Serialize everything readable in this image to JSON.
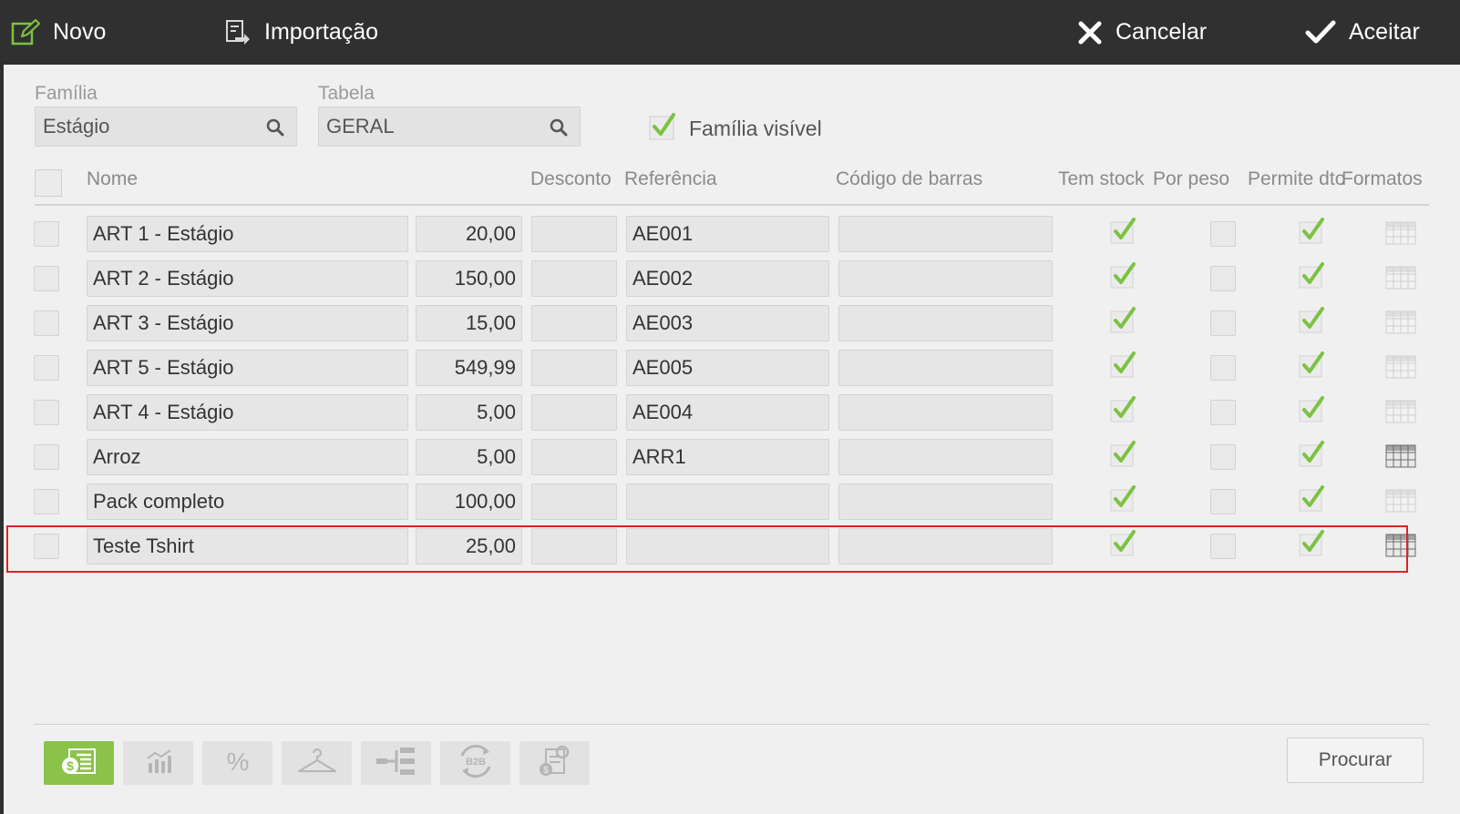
{
  "toolbar": {
    "novo": "Novo",
    "importacao": "Importação",
    "cancelar": "Cancelar",
    "aceitar": "Aceitar"
  },
  "filters": {
    "familia_label": "Família",
    "familia_value": "Estágio",
    "tabela_label": "Tabela",
    "tabela_value": "GERAL",
    "familia_visivel_label": "Família visível",
    "familia_visivel_checked": true
  },
  "grid": {
    "headers": {
      "nome": "Nome",
      "desconto": "Desconto",
      "referencia": "Referência",
      "codigo_barras": "Código de barras",
      "tem_stock": "Tem stock",
      "por_peso": "Por peso",
      "permite_dto": "Permite dto",
      "formatos": "Formatos"
    },
    "rows": [
      {
        "nome": "ART 1 - Estágio",
        "preco": "20,00",
        "desconto": "",
        "referencia": "AE001",
        "codigo_barras": "",
        "tem_stock": true,
        "por_peso": false,
        "permite_dto": true,
        "formatos_active": false
      },
      {
        "nome": "ART 2 - Estágio",
        "preco": "150,00",
        "desconto": "",
        "referencia": "AE002",
        "codigo_barras": "",
        "tem_stock": true,
        "por_peso": false,
        "permite_dto": true,
        "formatos_active": false
      },
      {
        "nome": "ART 3 - Estágio",
        "preco": "15,00",
        "desconto": "",
        "referencia": "AE003",
        "codigo_barras": "",
        "tem_stock": true,
        "por_peso": false,
        "permite_dto": true,
        "formatos_active": false
      },
      {
        "nome": "ART 5 -  Estágio",
        "preco": "549,99",
        "desconto": "",
        "referencia": "AE005",
        "codigo_barras": "",
        "tem_stock": true,
        "por_peso": false,
        "permite_dto": true,
        "formatos_active": false
      },
      {
        "nome": "ART 4 - Estágio",
        "preco": "5,00",
        "desconto": "",
        "referencia": "AE004",
        "codigo_barras": "",
        "tem_stock": true,
        "por_peso": false,
        "permite_dto": true,
        "formatos_active": false
      },
      {
        "nome": "Arroz",
        "preco": "5,00",
        "desconto": "",
        "referencia": "ARR1",
        "codigo_barras": "",
        "tem_stock": true,
        "por_peso": false,
        "permite_dto": true,
        "formatos_active": true
      },
      {
        "nome": "Pack completo",
        "preco": "100,00",
        "desconto": "",
        "referencia": "",
        "codigo_barras": "",
        "tem_stock": true,
        "por_peso": false,
        "permite_dto": true,
        "formatos_active": false
      },
      {
        "nome": "Teste Tshirt",
        "preco": "25,00",
        "desconto": "",
        "referencia": "",
        "codigo_barras": "",
        "tem_stock": true,
        "por_peso": false,
        "permite_dto": true,
        "formatos_active": true
      }
    ]
  },
  "bottom": {
    "tools": [
      "price-list-icon",
      "chart-icon",
      "percent-icon",
      "hanger-icon",
      "hierarchy-icon",
      "b2b-icon",
      "price-settings-icon"
    ],
    "procurar": "Procurar"
  },
  "colors": {
    "toolbar_bg": "#303030",
    "panel_bg": "#f0f0f0",
    "accent_green": "#8bc34a",
    "highlight_red": "#d9242a"
  }
}
